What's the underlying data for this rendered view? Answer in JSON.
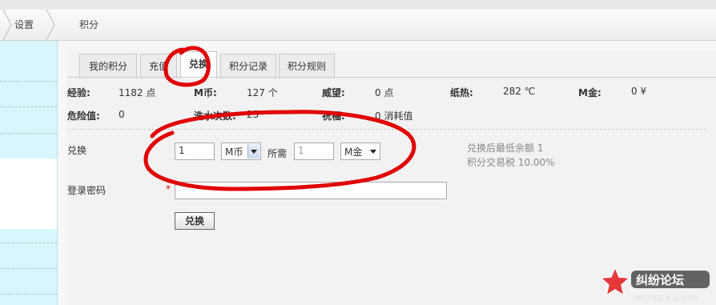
{
  "breadcrumb": {
    "items": [
      "设置",
      "积分"
    ]
  },
  "tabs": [
    "我的积分",
    "充值",
    "兑换",
    "积分记录",
    "积分规则"
  ],
  "stats": {
    "row1": [
      {
        "label": "经验:",
        "value": "1182 点"
      },
      {
        "label": "M币:",
        "value": "127 个"
      },
      {
        "label": "威望:",
        "value": "0 点"
      },
      {
        "label": "纸热:",
        "value": "282 ℃"
      },
      {
        "label": "M金:",
        "value": "0 ¥"
      }
    ],
    "row2": [
      {
        "label": "危险值:",
        "value": "0"
      },
      {
        "label": "洗水次数:",
        "value": "25"
      },
      {
        "label": "祝福:",
        "value": "0 消耗值"
      }
    ]
  },
  "exchange": {
    "label": "兑换",
    "amount": "1",
    "from_currency": "M币",
    "needs_label": "所需",
    "needs_value": "1",
    "to_currency": "M金",
    "hint_min": "兑换后最低余额 1",
    "hint_tax": "积分交易税 10.00%"
  },
  "password": {
    "label": "登录密码",
    "required_mark": "*",
    "value": ""
  },
  "submit_label": "兑换",
  "watermark": {
    "brand": "纠纷论坛",
    "site": "mzxzx.com"
  },
  "colors": {
    "annotation": "#e00000",
    "sidebar": "#d8f7fc"
  }
}
